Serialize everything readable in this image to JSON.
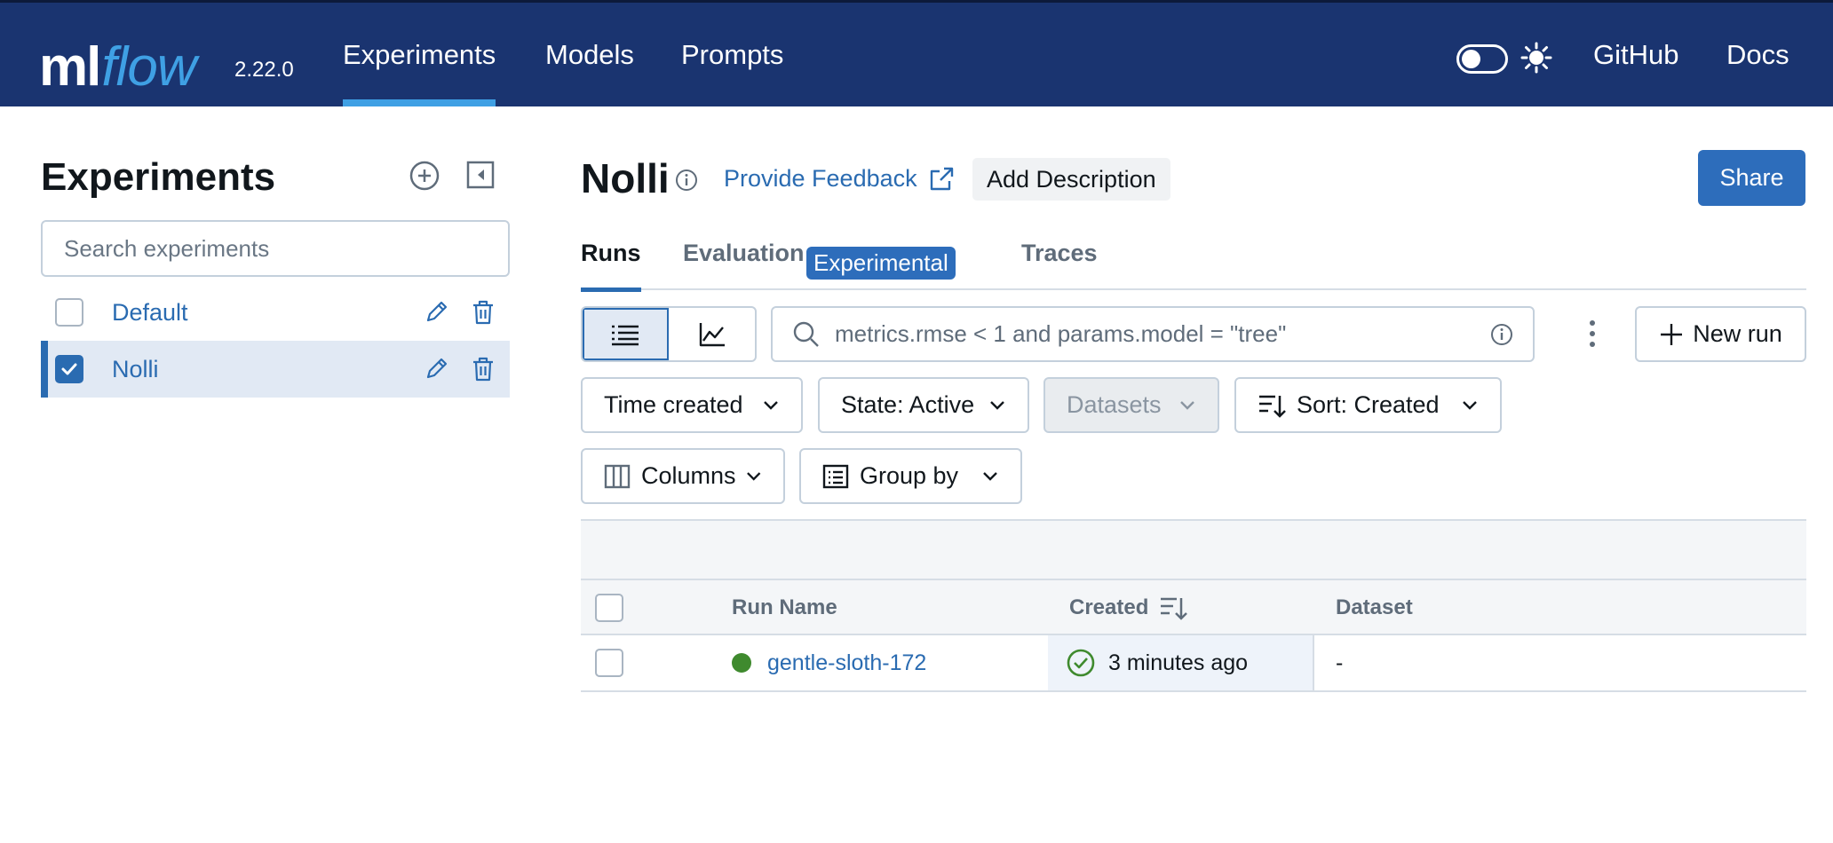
{
  "nav": {
    "logo_main": "ml",
    "logo_accent": "flow",
    "version": "2.22.0",
    "links": [
      "Experiments",
      "Models",
      "Prompts"
    ],
    "right_links": [
      "GitHub",
      "Docs"
    ],
    "theme_toggle_on": false
  },
  "sidebar": {
    "title": "Experiments",
    "search_placeholder": "Search experiments",
    "experiments": [
      {
        "name": "Default",
        "checked": false,
        "selected": false
      },
      {
        "name": "Nolli",
        "checked": true,
        "selected": true
      }
    ]
  },
  "main": {
    "title": "Nolli",
    "feedback_label": "Provide Feedback",
    "add_description_label": "Add Description",
    "share_label": "Share",
    "tabs": [
      "Runs",
      "Evaluation",
      "Traces"
    ],
    "evaluation_badge": "Experimental",
    "active_tab": "Runs"
  },
  "toolbar": {
    "search_value": "metrics.rmse < 1 and params.model = \"tree\"",
    "new_run_label": "New run",
    "time_filter": "Time created",
    "state_filter": "State: Active",
    "datasets_filter": "Datasets",
    "sort_label": "Sort: Created",
    "columns_label": "Columns",
    "group_by_label": "Group by"
  },
  "table": {
    "headers": [
      "Run Name",
      "Created",
      "Dataset"
    ],
    "rows": [
      {
        "run_name": "gentle-sloth-172",
        "created": "3 minutes ago",
        "dataset": "-",
        "status": "finished"
      }
    ]
  },
  "colors": {
    "nav_bg": "#1a3470",
    "accent": "#3fa0e4",
    "primary": "#2d6dbb",
    "link": "#2a6bb1",
    "success": "#3f8a2e"
  }
}
